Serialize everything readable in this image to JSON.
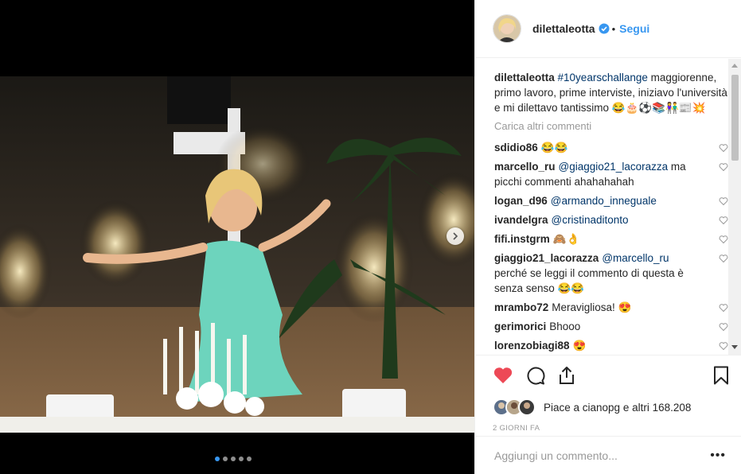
{
  "post": {
    "username": "dilettaleotta",
    "follow_label": "Segui",
    "bullet": "•",
    "caption_user": "dilettaleotta",
    "caption_hashtag": "#10yearschallange",
    "caption_text": "maggiorenne, primo lavoro, prime interviste, iniziavo l'università e mi dilettavo tantissimo 😂🎂⚽📚👫📰💥",
    "load_more": "Carica altri commenti",
    "comments": [
      {
        "user": "sdidio86",
        "mention": "",
        "text": "😂😂"
      },
      {
        "user": "marcello_ru",
        "mention": "@giaggio21_lacorazza",
        "text": "ma picchi commenti ahahahahah"
      },
      {
        "user": "logan_d96",
        "mention": "@armando_inneguale",
        "text": ""
      },
      {
        "user": "ivandelgra",
        "mention": "@cristinaditonto",
        "text": ""
      },
      {
        "user": "fifi.instgrm",
        "mention": "",
        "text": "🙈👌"
      },
      {
        "user": "giaggio21_lacorazza",
        "mention": "@marcello_ru",
        "text": "perché se leggi il commento di questa è senza senso 😂😂"
      },
      {
        "user": "mrambo72",
        "mention": "",
        "text": "Meravigliosa! 😍"
      },
      {
        "user": "gerimorici",
        "mention": "",
        "text": "Bhooo"
      },
      {
        "user": "lorenzobiagi88",
        "mention": "",
        "text": "😍"
      }
    ],
    "likes_text": "Piace a cianopg e altri 168.208",
    "timestamp": "2 GIORNI FA",
    "comment_placeholder": "Aggiungi un commento...",
    "more_options": "•••",
    "carousel": {
      "total": 5,
      "active": 1
    }
  },
  "colors": {
    "accent": "#3897f0",
    "like_red": "#ed4956",
    "text": "#262626",
    "muted": "#999999"
  },
  "icons": [
    "verified-badge-icon",
    "heart-filled-icon",
    "comment-icon",
    "share-icon",
    "bookmark-icon",
    "heart-outline-icon",
    "chevron-right-icon"
  ]
}
